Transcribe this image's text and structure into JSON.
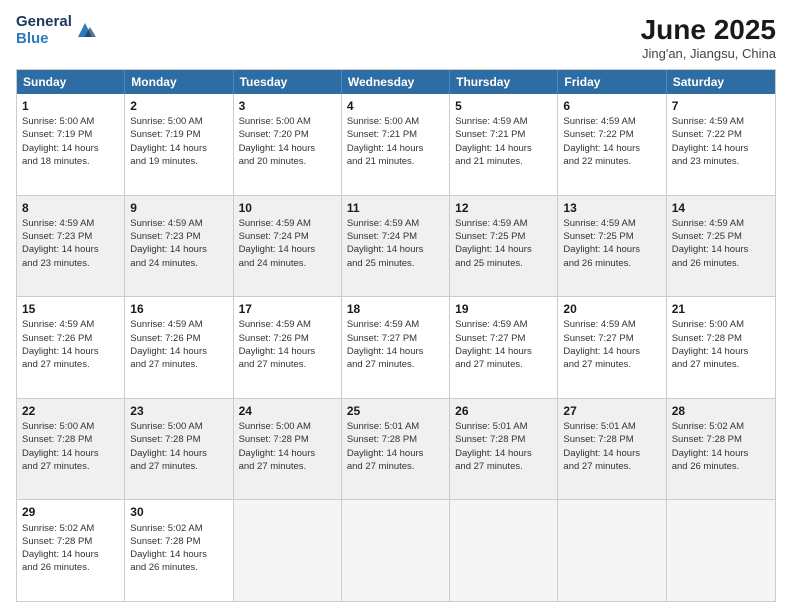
{
  "logo": {
    "general": "General",
    "blue": "Blue"
  },
  "title": "June 2025",
  "subtitle": "Jing'an, Jiangsu, China",
  "header_days": [
    "Sunday",
    "Monday",
    "Tuesday",
    "Wednesday",
    "Thursday",
    "Friday",
    "Saturday"
  ],
  "weeks": [
    [
      {
        "day": "1",
        "lines": [
          "Sunrise: 5:00 AM",
          "Sunset: 7:19 PM",
          "Daylight: 14 hours",
          "and 18 minutes."
        ],
        "shaded": false
      },
      {
        "day": "2",
        "lines": [
          "Sunrise: 5:00 AM",
          "Sunset: 7:19 PM",
          "Daylight: 14 hours",
          "and 19 minutes."
        ],
        "shaded": false
      },
      {
        "day": "3",
        "lines": [
          "Sunrise: 5:00 AM",
          "Sunset: 7:20 PM",
          "Daylight: 14 hours",
          "and 20 minutes."
        ],
        "shaded": false
      },
      {
        "day": "4",
        "lines": [
          "Sunrise: 5:00 AM",
          "Sunset: 7:21 PM",
          "Daylight: 14 hours",
          "and 21 minutes."
        ],
        "shaded": false
      },
      {
        "day": "5",
        "lines": [
          "Sunrise: 4:59 AM",
          "Sunset: 7:21 PM",
          "Daylight: 14 hours",
          "and 21 minutes."
        ],
        "shaded": false
      },
      {
        "day": "6",
        "lines": [
          "Sunrise: 4:59 AM",
          "Sunset: 7:22 PM",
          "Daylight: 14 hours",
          "and 22 minutes."
        ],
        "shaded": false
      },
      {
        "day": "7",
        "lines": [
          "Sunrise: 4:59 AM",
          "Sunset: 7:22 PM",
          "Daylight: 14 hours",
          "and 23 minutes."
        ],
        "shaded": false
      }
    ],
    [
      {
        "day": "8",
        "lines": [
          "Sunrise: 4:59 AM",
          "Sunset: 7:23 PM",
          "Daylight: 14 hours",
          "and 23 minutes."
        ],
        "shaded": true
      },
      {
        "day": "9",
        "lines": [
          "Sunrise: 4:59 AM",
          "Sunset: 7:23 PM",
          "Daylight: 14 hours",
          "and 24 minutes."
        ],
        "shaded": true
      },
      {
        "day": "10",
        "lines": [
          "Sunrise: 4:59 AM",
          "Sunset: 7:24 PM",
          "Daylight: 14 hours",
          "and 24 minutes."
        ],
        "shaded": true
      },
      {
        "day": "11",
        "lines": [
          "Sunrise: 4:59 AM",
          "Sunset: 7:24 PM",
          "Daylight: 14 hours",
          "and 25 minutes."
        ],
        "shaded": true
      },
      {
        "day": "12",
        "lines": [
          "Sunrise: 4:59 AM",
          "Sunset: 7:25 PM",
          "Daylight: 14 hours",
          "and 25 minutes."
        ],
        "shaded": true
      },
      {
        "day": "13",
        "lines": [
          "Sunrise: 4:59 AM",
          "Sunset: 7:25 PM",
          "Daylight: 14 hours",
          "and 26 minutes."
        ],
        "shaded": true
      },
      {
        "day": "14",
        "lines": [
          "Sunrise: 4:59 AM",
          "Sunset: 7:25 PM",
          "Daylight: 14 hours",
          "and 26 minutes."
        ],
        "shaded": true
      }
    ],
    [
      {
        "day": "15",
        "lines": [
          "Sunrise: 4:59 AM",
          "Sunset: 7:26 PM",
          "Daylight: 14 hours",
          "and 27 minutes."
        ],
        "shaded": false
      },
      {
        "day": "16",
        "lines": [
          "Sunrise: 4:59 AM",
          "Sunset: 7:26 PM",
          "Daylight: 14 hours",
          "and 27 minutes."
        ],
        "shaded": false
      },
      {
        "day": "17",
        "lines": [
          "Sunrise: 4:59 AM",
          "Sunset: 7:26 PM",
          "Daylight: 14 hours",
          "and 27 minutes."
        ],
        "shaded": false
      },
      {
        "day": "18",
        "lines": [
          "Sunrise: 4:59 AM",
          "Sunset: 7:27 PM",
          "Daylight: 14 hours",
          "and 27 minutes."
        ],
        "shaded": false
      },
      {
        "day": "19",
        "lines": [
          "Sunrise: 4:59 AM",
          "Sunset: 7:27 PM",
          "Daylight: 14 hours",
          "and 27 minutes."
        ],
        "shaded": false
      },
      {
        "day": "20",
        "lines": [
          "Sunrise: 4:59 AM",
          "Sunset: 7:27 PM",
          "Daylight: 14 hours",
          "and 27 minutes."
        ],
        "shaded": false
      },
      {
        "day": "21",
        "lines": [
          "Sunrise: 5:00 AM",
          "Sunset: 7:28 PM",
          "Daylight: 14 hours",
          "and 27 minutes."
        ],
        "shaded": false
      }
    ],
    [
      {
        "day": "22",
        "lines": [
          "Sunrise: 5:00 AM",
          "Sunset: 7:28 PM",
          "Daylight: 14 hours",
          "and 27 minutes."
        ],
        "shaded": true
      },
      {
        "day": "23",
        "lines": [
          "Sunrise: 5:00 AM",
          "Sunset: 7:28 PM",
          "Daylight: 14 hours",
          "and 27 minutes."
        ],
        "shaded": true
      },
      {
        "day": "24",
        "lines": [
          "Sunrise: 5:00 AM",
          "Sunset: 7:28 PM",
          "Daylight: 14 hours",
          "and 27 minutes."
        ],
        "shaded": true
      },
      {
        "day": "25",
        "lines": [
          "Sunrise: 5:01 AM",
          "Sunset: 7:28 PM",
          "Daylight: 14 hours",
          "and 27 minutes."
        ],
        "shaded": true
      },
      {
        "day": "26",
        "lines": [
          "Sunrise: 5:01 AM",
          "Sunset: 7:28 PM",
          "Daylight: 14 hours",
          "and 27 minutes."
        ],
        "shaded": true
      },
      {
        "day": "27",
        "lines": [
          "Sunrise: 5:01 AM",
          "Sunset: 7:28 PM",
          "Daylight: 14 hours",
          "and 27 minutes."
        ],
        "shaded": true
      },
      {
        "day": "28",
        "lines": [
          "Sunrise: 5:02 AM",
          "Sunset: 7:28 PM",
          "Daylight: 14 hours",
          "and 26 minutes."
        ],
        "shaded": true
      }
    ],
    [
      {
        "day": "29",
        "lines": [
          "Sunrise: 5:02 AM",
          "Sunset: 7:28 PM",
          "Daylight: 14 hours",
          "and 26 minutes."
        ],
        "shaded": false
      },
      {
        "day": "30",
        "lines": [
          "Sunrise: 5:02 AM",
          "Sunset: 7:28 PM",
          "Daylight: 14 hours",
          "and 26 minutes."
        ],
        "shaded": false
      },
      {
        "day": "",
        "lines": [],
        "shaded": false,
        "empty": true
      },
      {
        "day": "",
        "lines": [],
        "shaded": false,
        "empty": true
      },
      {
        "day": "",
        "lines": [],
        "shaded": false,
        "empty": true
      },
      {
        "day": "",
        "lines": [],
        "shaded": false,
        "empty": true
      },
      {
        "day": "",
        "lines": [],
        "shaded": false,
        "empty": true
      }
    ]
  ]
}
